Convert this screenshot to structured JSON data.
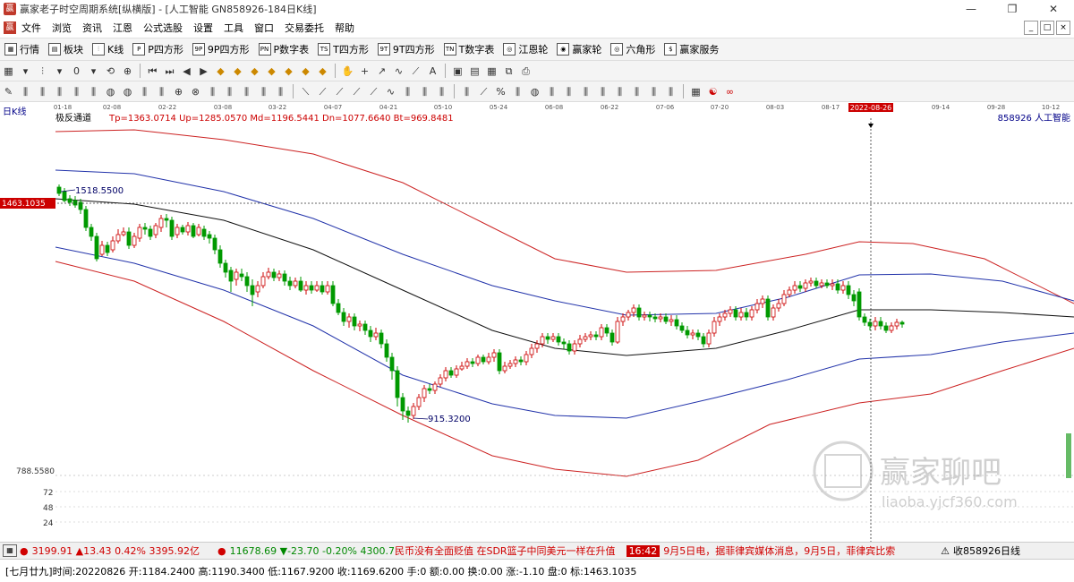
{
  "window": {
    "title": "赢家老子时空周期系统[纵横版] - [人工智能  GN858926-184日K线]",
    "controls": [
      "—",
      "❐",
      "✕"
    ]
  },
  "menu": {
    "items": [
      "文件",
      "浏览",
      "资讯",
      "江恩",
      "公式选股",
      "设置",
      "工具",
      "窗口",
      "交易委托",
      "帮助"
    ],
    "mdi_controls": [
      "_",
      "□",
      "×"
    ]
  },
  "toolbar": {
    "items": [
      {
        "icon": "grid-icon",
        "glyph": "▦",
        "label": "行情"
      },
      {
        "icon": "blocks-icon",
        "glyph": "▤",
        "label": "板块"
      },
      {
        "icon": "candle-icon",
        "glyph": "⫶",
        "label": "K线"
      },
      {
        "icon": "p-icon",
        "glyph": "P",
        "label": "P四方形"
      },
      {
        "icon": "9p-icon",
        "glyph": "9P",
        "label": "9P四方形"
      },
      {
        "icon": "pn-icon",
        "glyph": "PN",
        "label": "P数字表"
      },
      {
        "icon": "t-icon",
        "glyph": "TS",
        "label": "T四方形"
      },
      {
        "icon": "9t-icon",
        "glyph": "9T",
        "label": "9T四方形"
      },
      {
        "icon": "tn-icon",
        "glyph": "TN",
        "label": "T数字表"
      },
      {
        "icon": "gann-wheel-icon",
        "glyph": "◎",
        "label": "江恩轮"
      },
      {
        "icon": "winner-wheel-icon",
        "glyph": "◉",
        "label": "赢家轮"
      },
      {
        "icon": "hexagon-icon",
        "glyph": "◎",
        "label": "六角形"
      },
      {
        "icon": "service-icon",
        "glyph": "$",
        "label": "赢家服务"
      }
    ]
  },
  "chart": {
    "period_label": "日K线",
    "indicator_name": "极反通道",
    "indicator_values": "Tp=1363.0714  Up=1285.0570  Md=1196.5441  Dn=1077.6640  Bt=969.8481",
    "symbol_label": "858926  人工智能",
    "cursor_price": "1463.1035",
    "cursor_date": "2022-08-26",
    "high_label": "1518.5500",
    "low_label": "915.3200",
    "y_axis_labels": [
      "788.5580",
      "72",
      "48",
      "24"
    ],
    "date_ticks": [
      "01-18",
      "02-08",
      "02-22",
      "03-08",
      "03-22",
      "04-07",
      "04-21",
      "05-10",
      "05-24",
      "06-08",
      "06-22",
      "07-06",
      "07-20",
      "08-03",
      "08-17",
      "09-14",
      "09-28",
      "10-12"
    ],
    "colors": {
      "red_band": "#cc2222",
      "blue_band": "#2233aa",
      "mid_line": "#111111",
      "candle_up": "#cc0000",
      "candle_down": "#009900"
    }
  },
  "watermark": {
    "title": "赢家聊吧",
    "url": "liaoba.yjcf360.com"
  },
  "status_bar": {
    "index1": "3199.91",
    "index1_change": "▲13.43",
    "index1_pct": "0.42%",
    "index1_amount": "3395.92亿",
    "index2": "11678.69",
    "index2_change": "▼-23.70",
    "index2_pct": "-0.20%",
    "index2_amount": "4300.7",
    "news": "民币没有全面贬值 在SDR篮子中同美元一样在升值",
    "time_badge": "16:42",
    "news2": "9月5日电，据菲律宾媒体消息，9月5日，菲律宾比索",
    "watch_label": "收858926日线"
  },
  "info_bar": {
    "lunar": "[七月廿九]",
    "time": "时间:20220826",
    "open": "开:1184.2400",
    "high": "高:1190.3400",
    "low": "低:1167.9200",
    "close": "收:1169.6200",
    "hand": "手:0",
    "amount": "额:0.00",
    "turnover": "换:0.00",
    "change": "涨:-1.10",
    "disk": "盘:0",
    "mark": "标:1463.1035"
  }
}
